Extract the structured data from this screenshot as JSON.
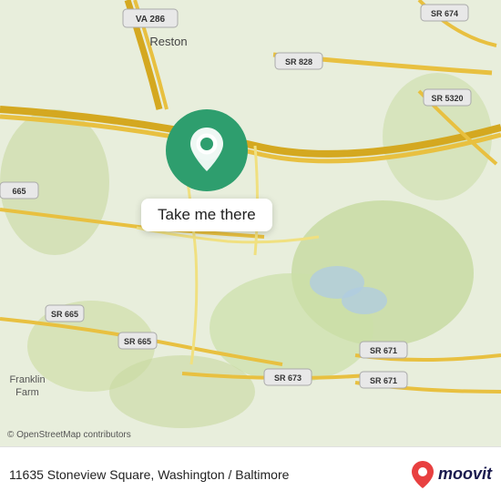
{
  "map": {
    "popup_label": "Take me there",
    "copyright": "© OpenStreetMap contributors",
    "address": "11635 Stoneview Square, Washington / Baltimore",
    "moovit_label": "moovit"
  },
  "icons": {
    "pin": "📍",
    "location": "◉"
  }
}
